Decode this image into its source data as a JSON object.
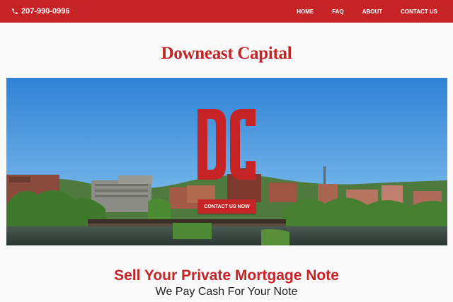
{
  "header": {
    "phone": "207-990-0996",
    "nav": [
      {
        "label": "HOME"
      },
      {
        "label": "FAQ"
      },
      {
        "label": "ABOUT"
      },
      {
        "label": "CONTACT US"
      }
    ],
    "bar_color": "#c62326"
  },
  "brand": {
    "title": "Downeast Capital",
    "logo_letters": "DC"
  },
  "hero": {
    "cta_label": "CONTACT US NOW"
  },
  "content": {
    "headline": "Sell Your Private Mortgage Note",
    "subheadline": "We Pay Cash For Your Note"
  },
  "icons": {
    "phone": "phone-icon"
  }
}
